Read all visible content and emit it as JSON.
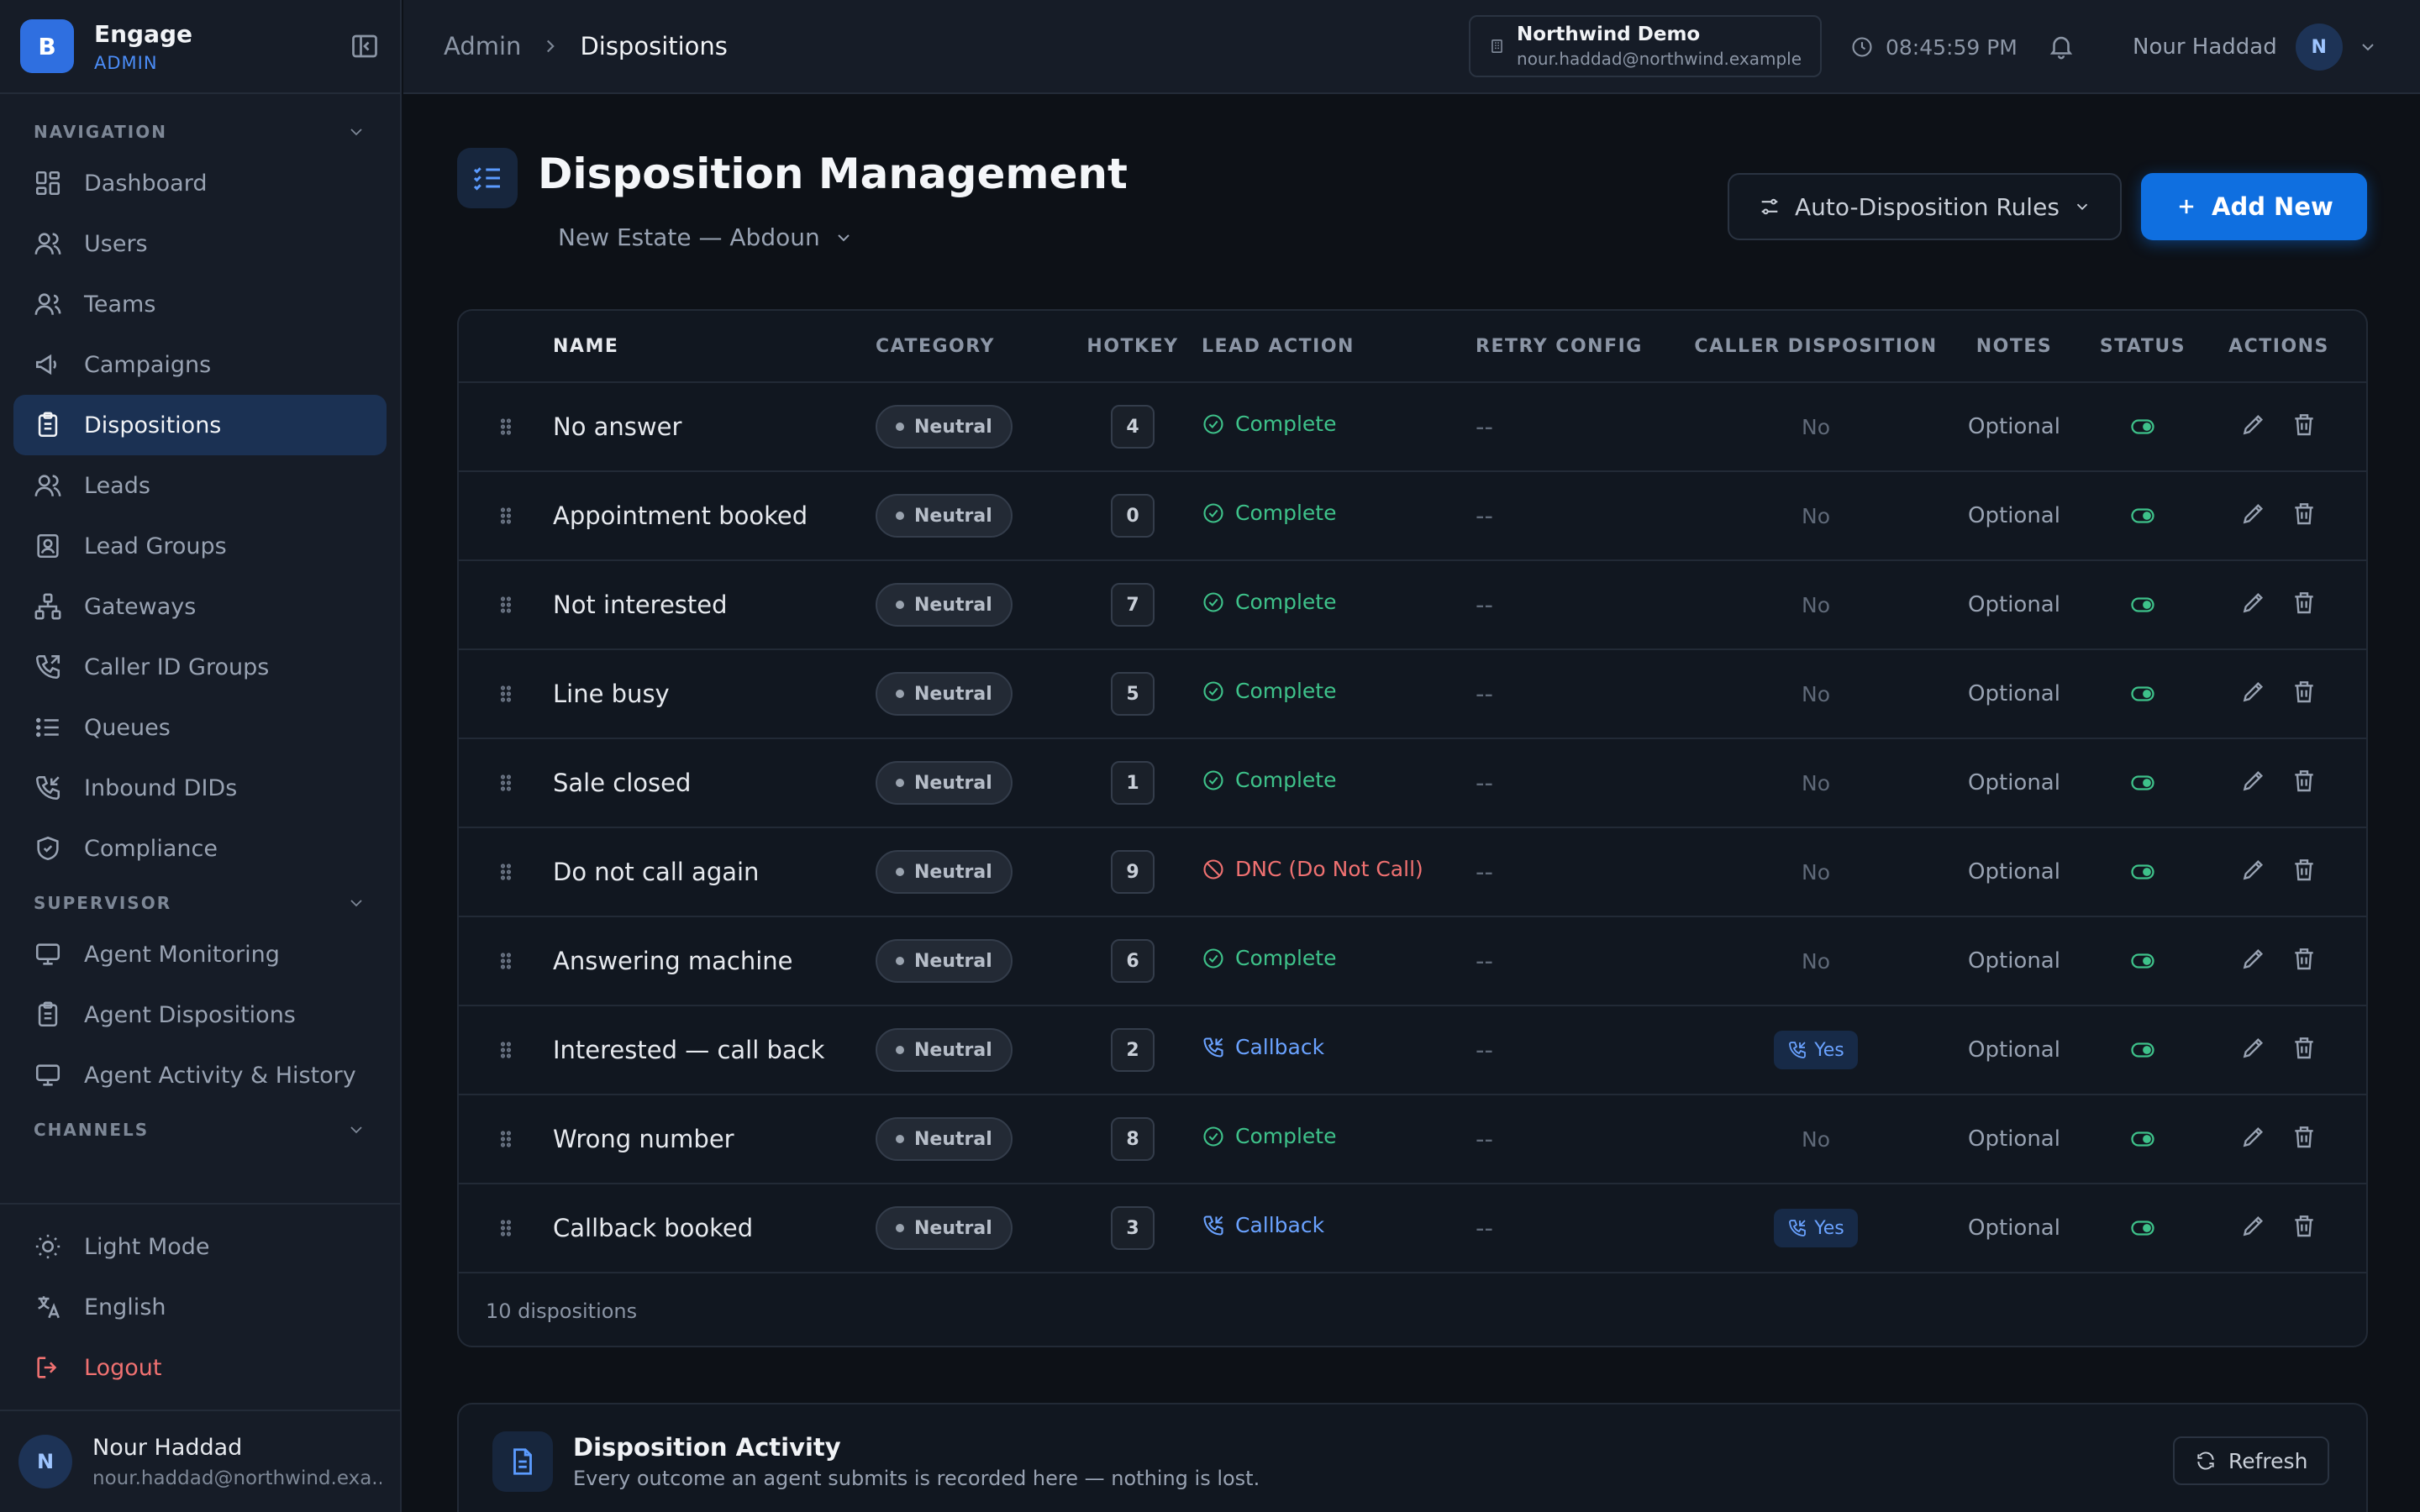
{
  "brand": {
    "initial": "B",
    "name": "Engage",
    "role": "ADMIN"
  },
  "sidebar": {
    "sections": [
      {
        "title": "NAVIGATION",
        "items": [
          {
            "label": "Dashboard",
            "icon": "dashboard-icon"
          },
          {
            "label": "Users",
            "icon": "users-icon"
          },
          {
            "label": "Teams",
            "icon": "teams-icon"
          },
          {
            "label": "Campaigns",
            "icon": "megaphone-icon"
          },
          {
            "label": "Dispositions",
            "icon": "clipboard-icon",
            "active": true
          },
          {
            "label": "Leads",
            "icon": "leads-icon"
          },
          {
            "label": "Lead Groups",
            "icon": "lead-groups-icon"
          },
          {
            "label": "Gateways",
            "icon": "network-icon"
          },
          {
            "label": "Caller ID Groups",
            "icon": "phone-forward-icon"
          },
          {
            "label": "Queues",
            "icon": "list-icon"
          },
          {
            "label": "Inbound DIDs",
            "icon": "phone-incoming-icon"
          },
          {
            "label": "Compliance",
            "icon": "shield-check-icon"
          }
        ]
      },
      {
        "title": "SUPERVISOR",
        "items": [
          {
            "label": "Agent Monitoring",
            "icon": "monitor-icon"
          },
          {
            "label": "Agent Dispositions",
            "icon": "clipboard-icon"
          },
          {
            "label": "Agent Activity & History",
            "icon": "monitor-icon"
          }
        ]
      },
      {
        "title": "CHANNELS",
        "items": []
      }
    ],
    "bottom": {
      "light_mode": "Light Mode",
      "language": "English",
      "logout": "Logout"
    },
    "user": {
      "initial": "N",
      "name": "Nour Haddad",
      "email": "nour.haddad@northwind.exa..."
    }
  },
  "topbar": {
    "breadcrumb_root": "Admin",
    "breadcrumb_current": "Dispositions",
    "org_name": "Northwind Demo",
    "org_email": "nour.haddad@northwind.example",
    "clock": "08:45:59 PM",
    "user_name": "Nour Haddad",
    "user_initial": "N"
  },
  "page": {
    "title": "Disposition Management",
    "campaign_select": "New Estate — Abdoun",
    "rules_button": "Auto-Disposition Rules",
    "add_button": "Add New"
  },
  "table": {
    "headers": {
      "name": "NAME",
      "category": "CATEGORY",
      "hotkey": "HOTKEY",
      "lead_action": "LEAD ACTION",
      "retry": "RETRY CONFIG",
      "caller": "CALLER DISPOSITION",
      "notes": "NOTES",
      "status": "STATUS",
      "actions": "ACTIONS"
    },
    "rows": [
      {
        "name": "No answer",
        "category": "Neutral",
        "hotkey": "4",
        "lead_action": "Complete",
        "action_type": "complete",
        "retry": "--",
        "caller": "No",
        "notes": "Optional",
        "status": "on"
      },
      {
        "name": "Appointment booked",
        "category": "Neutral",
        "hotkey": "0",
        "lead_action": "Complete",
        "action_type": "complete",
        "retry": "--",
        "caller": "No",
        "notes": "Optional",
        "status": "on"
      },
      {
        "name": "Not interested",
        "category": "Neutral",
        "hotkey": "7",
        "lead_action": "Complete",
        "action_type": "complete",
        "retry": "--",
        "caller": "No",
        "notes": "Optional",
        "status": "on"
      },
      {
        "name": "Line busy",
        "category": "Neutral",
        "hotkey": "5",
        "lead_action": "Complete",
        "action_type": "complete",
        "retry": "--",
        "caller": "No",
        "notes": "Optional",
        "status": "on"
      },
      {
        "name": "Sale closed",
        "category": "Neutral",
        "hotkey": "1",
        "lead_action": "Complete",
        "action_type": "complete",
        "retry": "--",
        "caller": "No",
        "notes": "Optional",
        "status": "on"
      },
      {
        "name": "Do not call again",
        "category": "Neutral",
        "hotkey": "9",
        "lead_action": "DNC (Do Not Call)",
        "action_type": "dnc",
        "retry": "--",
        "caller": "No",
        "notes": "Optional",
        "status": "on"
      },
      {
        "name": "Answering machine",
        "category": "Neutral",
        "hotkey": "6",
        "lead_action": "Complete",
        "action_type": "complete",
        "retry": "--",
        "caller": "No",
        "notes": "Optional",
        "status": "on"
      },
      {
        "name": "Interested — call back",
        "category": "Neutral",
        "hotkey": "2",
        "lead_action": "Callback",
        "action_type": "callback",
        "retry": "--",
        "caller": "Yes",
        "notes": "Optional",
        "status": "on"
      },
      {
        "name": "Wrong number",
        "category": "Neutral",
        "hotkey": "8",
        "lead_action": "Complete",
        "action_type": "complete",
        "retry": "--",
        "caller": "No",
        "notes": "Optional",
        "status": "on"
      },
      {
        "name": "Callback booked",
        "category": "Neutral",
        "hotkey": "3",
        "lead_action": "Callback",
        "action_type": "callback",
        "retry": "--",
        "caller": "Yes",
        "notes": "Optional",
        "status": "on"
      }
    ],
    "footer": "10 dispositions"
  },
  "activity": {
    "title": "Disposition Activity",
    "subtitle": "Every outcome an agent submits is recorded here — nothing is lost.",
    "refresh": "Refresh"
  },
  "colors": {
    "accent": "#0f6fe0",
    "complete": "#3ec28a",
    "dnc": "#f07171",
    "callback": "#6aa2ff",
    "logout": "#f07171"
  }
}
